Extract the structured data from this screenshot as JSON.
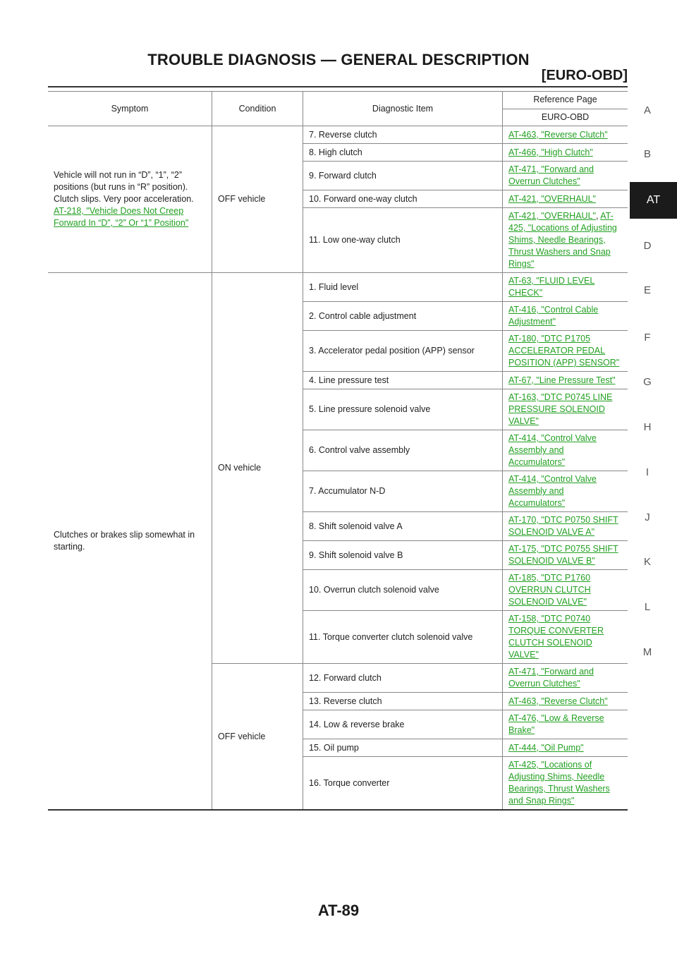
{
  "header": {
    "title": "TROUBLE DIAGNOSIS — GENERAL DESCRIPTION",
    "subtitle": "[EURO-OBD]"
  },
  "sidebar": {
    "letters": [
      "A",
      "B",
      "AT",
      "D",
      "E",
      "F",
      "G",
      "H",
      "I",
      "J",
      "K",
      "L",
      "M"
    ],
    "active": "AT"
  },
  "table": {
    "headers": {
      "symptom": "Symptom",
      "condition": "Condition",
      "diagnostic": "Diagnostic Item",
      "reference": "Reference Page",
      "reference_sub": "EURO-OBD"
    },
    "group1": {
      "symptom_text": "Vehicle will not run in “D”, “1”, “2” positions (but runs in “R” position). Clutch slips. Very poor acceleration.",
      "symptom_link": "AT-218, \"Vehicle Does Not Creep Forward In “D”, “2” Or “1” Position\"",
      "condition": "OFF vehicle",
      "rows": [
        {
          "item": "7. Reverse clutch",
          "ref": "AT-463, \"Reverse Clutch\""
        },
        {
          "item": "8. High clutch",
          "ref": "AT-466, \"High Clutch\""
        },
        {
          "item": "9. Forward clutch",
          "ref": "AT-471, \"Forward and Overrun Clutches\""
        },
        {
          "item": "10. Forward one-way clutch",
          "ref": "AT-421, \"OVERHAUL\""
        },
        {
          "item": "11. Low one-way clutch",
          "ref": "AT-421, \"OVERHAUL\"",
          "ref2": "AT-425, \"Locations of Adjusting Shims, Needle Bearings, Thrust Washers and Snap Rings\""
        }
      ]
    },
    "group2": {
      "symptom_text": "Clutches or brakes slip somewhat in starting.",
      "condition_on": "ON vehicle",
      "condition_off": "OFF vehicle",
      "rows_on": [
        {
          "item": "1. Fluid level",
          "ref": "AT-63, \"FLUID LEVEL CHECK\""
        },
        {
          "item": "2. Control cable adjustment",
          "ref": "AT-416, \"Control Cable Adjustment\""
        },
        {
          "item": "3. Accelerator pedal position (APP) sensor",
          "ref": "AT-180, \"DTC P1705 ACCELERATOR PEDAL POSITION (APP) SENSOR\""
        },
        {
          "item": "4. Line pressure test",
          "ref": "AT-67, \"Line Pressure Test\""
        },
        {
          "item": "5. Line pressure solenoid valve",
          "ref": "AT-163, \"DTC P0745 LINE PRESSURE SOLENOID VALVE\""
        },
        {
          "item": "6. Control valve assembly",
          "ref": "AT-414, \"Control Valve Assembly and Accumulators\""
        },
        {
          "item": "7. Accumulator N-D",
          "ref": "AT-414, \"Control Valve Assembly and Accumulators\""
        },
        {
          "item": "8. Shift solenoid valve A",
          "ref": "AT-170, \"DTC P0750 SHIFT SOLENOID VALVE A\""
        },
        {
          "item": "9. Shift solenoid valve B",
          "ref": "AT-175, \"DTC P0755 SHIFT SOLENOID VALVE B\""
        },
        {
          "item": "10. Overrun clutch solenoid valve",
          "ref": "AT-185, \"DTC P1760 OVERRUN CLUTCH SOLENOID VALVE\""
        },
        {
          "item": "11. Torque converter clutch solenoid valve",
          "ref": "AT-158, \"DTC P0740 TORQUE CONVERTER CLUTCH SOLENOID VALVE\""
        }
      ],
      "rows_off": [
        {
          "item": "12. Forward clutch",
          "ref": "AT-471, \"Forward and Overrun Clutches\""
        },
        {
          "item": "13. Reverse clutch",
          "ref": "AT-463, \"Reverse Clutch\""
        },
        {
          "item": "14. Low & reverse brake",
          "ref": "AT-476, \"Low & Reverse Brake\""
        },
        {
          "item": "15. Oil pump",
          "ref": "AT-444, \"Oil Pump\""
        },
        {
          "item": "16. Torque converter",
          "ref": "AT-425, \"Locations of Adjusting Shims, Needle Bearings, Thrust Washers and Snap Rings\""
        }
      ]
    }
  },
  "footer": {
    "page_number": "AT-89"
  },
  "colors": {
    "link": "#22a022",
    "sidebar_active_bg": "#1b1b1b"
  }
}
